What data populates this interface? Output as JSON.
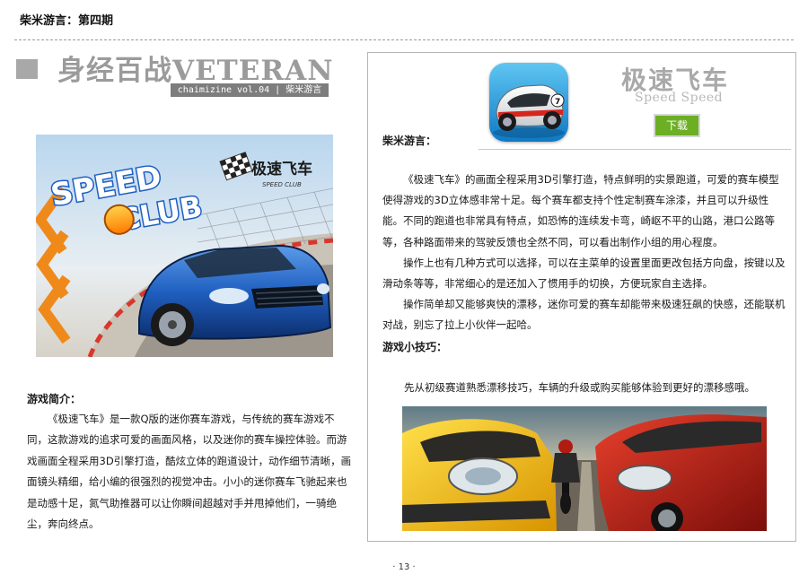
{
  "header": {
    "issue": "柴米游言：第四期"
  },
  "title": {
    "main": "身经百战VETERAN",
    "sub": "chaimizine vol.04 | 柴米游言"
  },
  "cover": {
    "logo_top": "SPEED",
    "logo_bottom": "CLUB",
    "cn_logo": "极速飞车",
    "cn_logo_en": "SPEED CLUB"
  },
  "intro": {
    "heading": "游戏简介：",
    "text": "《极速飞车》是一款Q版的迷你赛车游戏，与传统的赛车游戏不同，这款游戏的追求可爱的画面风格，以及迷你的赛车操控体验。而游戏画面全程采用3D引擎打造，酷炫立体的跑道设计，动作细节清晰，画面镜头精细，给小编的很强烈的视觉冲击。小小的迷你赛车飞驰起来也是动感十足，氮气助推器可以让你瞬间超越对手并甩掉他们，一骑绝尘，奔向终点。"
  },
  "app": {
    "name_cn": "极速飞车",
    "name_en": "Speed Speed",
    "download": "下载",
    "icon_number": "7"
  },
  "review": {
    "label": "柴米游言：",
    "p1": "《极速飞车》的画面全程采用3D引擎打造，特点鲜明的实景跑道，可爱的赛车模型使得游戏的3D立体感非常十足。每个赛车都支持个性定制赛车涂漆，并且可以升级性能。不同的跑道也非常具有特点，如恐怖的连续发卡弯，崎岖不平的山路，港口公路等等，各种路面带来的驾驶反馈也全然不同，可以看出制作小组的用心程度。",
    "p2": "操作上也有几种方式可以选择，可以在主菜单的设置里面更改包括方向盘，按键以及滑动条等等，非常细心的是还加入了惯用手的切换，方便玩家自主选择。",
    "p3": "操作简单却又能够爽快的漂移，迷你可爱的赛车却能带来极速狂飙的快感，还能联机对战，别忘了拉上小伙伴一起哈。"
  },
  "tips": {
    "heading": "游戏小技巧：",
    "text": "先从初级赛道熟悉漂移技巧，车辆的升级或购买能够体验到更好的漂移感哦。"
  },
  "footer": {
    "page": "· 13 ·"
  }
}
